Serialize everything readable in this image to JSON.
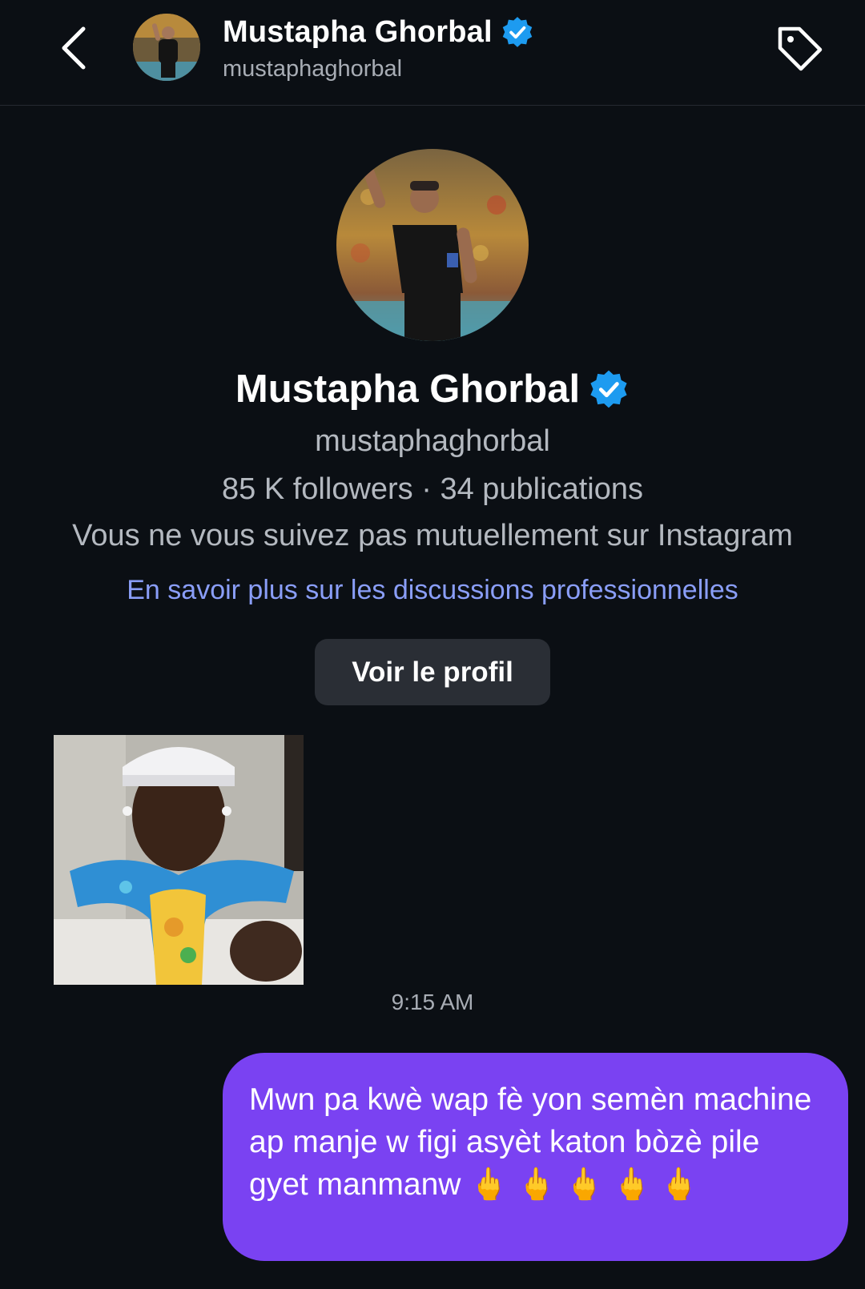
{
  "header": {
    "name": "Mustapha Ghorbal",
    "username": "mustaphaghorbal"
  },
  "profile": {
    "name": "Mustapha Ghorbal",
    "username": "mustaphaghorbal",
    "stats": "85 K followers · 34 publications",
    "mutual_status": "Vous ne vous suivez pas mutuellement sur Instagram",
    "learn_more_link": "En savoir plus sur les discussions professionnelles",
    "view_profile_label": "Voir le profil"
  },
  "messages": {
    "timestamp": "9:15 AM",
    "outgoing_text": "Mwn pa kwè wap fè yon semèn machine ap manje w figi asyèt katon bòzè pile gyet manmanw 🖕 🖕 🖕 🖕 🖕"
  },
  "icons": {
    "back": "chevron-left-icon",
    "tag": "tag-icon",
    "verified": "verified-badge-icon"
  },
  "colors": {
    "background": "#0b0f14",
    "accent_link": "#8a9ef8",
    "verified_blue": "#1d9bf0",
    "outgoing_bubble": "#7a42f2",
    "button_bg": "#2a2e35"
  }
}
